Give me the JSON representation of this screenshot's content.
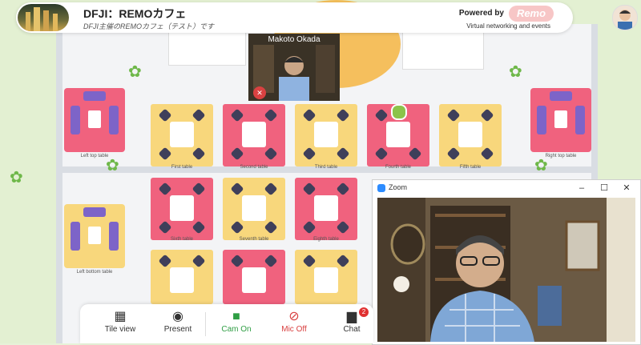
{
  "header": {
    "title": "DFJI：REMOカフェ",
    "subtitle": "DFJI主催のREMOカフェ（テスト）です",
    "powered_by": "Powered by",
    "brand": "Remo",
    "tagline": "Virtual networking and events"
  },
  "tables": [
    {
      "label": "Left top table"
    },
    {
      "label": "First table"
    },
    {
      "label": "Second table"
    },
    {
      "label": "Third table"
    },
    {
      "label": "Fourth table"
    },
    {
      "label": "Fifth table"
    },
    {
      "label": "Right top table"
    },
    {
      "label": "Sixth table"
    },
    {
      "label": "Seventh table"
    },
    {
      "label": "Eighth table"
    },
    {
      "label": "Left bottom table"
    }
  ],
  "video_tile": {
    "name": "Makoto Okada"
  },
  "zoom": {
    "title": "Zoom",
    "minimize": "–",
    "maximize": "☐",
    "close": "✕"
  },
  "toolbar": {
    "tile_view": "Tile view",
    "present": "Present",
    "cam_on": "Cam On",
    "mic_off": "Mic Off",
    "chat": "Chat",
    "chat_badge": "2"
  },
  "colors": {
    "accent_green": "#2f9e44",
    "mic_red": "#d94141",
    "remo_pink": "#f7c6c6"
  }
}
